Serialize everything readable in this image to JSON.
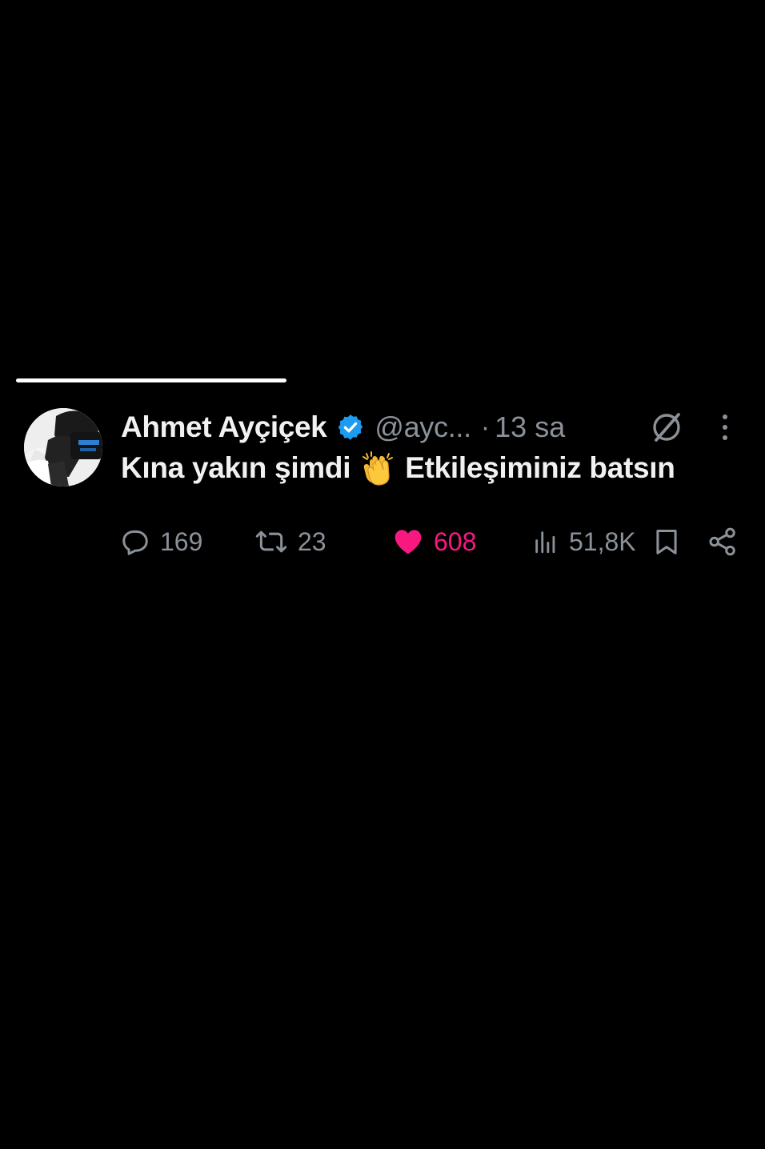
{
  "tweet": {
    "author": {
      "display_name": "Ahmet Ayçiçek",
      "handle": "@ayc...",
      "verified": true,
      "verified_icon": "verified-badge-icon",
      "verified_color": "#1d9bf0"
    },
    "separator": "·",
    "time": "13 sa",
    "text_before_emoji": "Kına yakın şimdi",
    "emoji": "clapping-hands-icon",
    "text_after_emoji": "Etkileşiminiz batsın",
    "actions": {
      "replies": "169",
      "retweets": "23",
      "likes": "608",
      "views": "51,8K"
    },
    "like_color": "#f91880",
    "muted_color": "#8b9198"
  }
}
